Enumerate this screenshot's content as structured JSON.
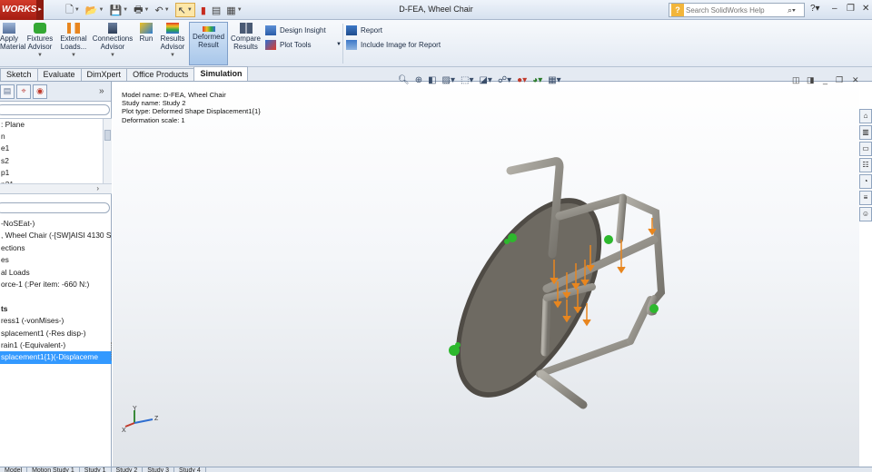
{
  "titlebar": {
    "brand": "WORKS",
    "document_title": "D-FEA, Wheel Chair",
    "help_placeholder": "Search SolidWorks Help"
  },
  "ribbon": {
    "apply_material": "Apply\nMaterial",
    "fixtures_advisor": "Fixtures\nAdvisor",
    "external_loads": "External\nLoads...",
    "connections_advisor": "Connections\nAdvisor",
    "run": "Run",
    "results_advisor": "Results\nAdvisor",
    "deformed_result": "Deformed\nResult",
    "compare_results": "Compare\nResults",
    "design_insight": "Design Insight",
    "plot_tools": "Plot Tools",
    "report": "Report",
    "include_image": "Include Image for Report"
  },
  "command_tabs": [
    "Sketch",
    "Evaluate",
    "DimXpert",
    "Office Products",
    "Simulation"
  ],
  "left_panel": {
    "upper_items": [
      ": Plane",
      "n",
      "e1",
      "s2",
      "p1",
      "p21"
    ],
    "tree_items": [
      {
        "label": "-NoSEat-)",
        "style": ""
      },
      {
        "label": ", Wheel Chair (-[SW]AISI 4130 S",
        "style": ""
      },
      {
        "label": "ections",
        "style": ""
      },
      {
        "label": "es",
        "style": ""
      },
      {
        "label": "al Loads",
        "style": ""
      },
      {
        "label": "orce-1 (:Per item: -660 N:)",
        "style": ""
      },
      {
        "label": "",
        "style": ""
      },
      {
        "label": "ts",
        "style": "bold"
      },
      {
        "label": "ress1 (-vonMises-)",
        "style": ""
      },
      {
        "label": "splacement1 (-Res disp-)",
        "style": ""
      },
      {
        "label": "rain1 (-Equivalent-)",
        "style": ""
      },
      {
        "label": "splacement1{1}(-Displaceme",
        "style": "selected"
      }
    ]
  },
  "viewport": {
    "info_lines": [
      "Model name: D-FEA, Wheel Chair",
      "Study name: Study 2",
      "Plot type: Deformed Shape Displacement1{1}",
      "Deformation scale: 1"
    ],
    "triad": {
      "x": "X",
      "y": "Y",
      "z": "Z"
    }
  },
  "bottom_tabs": [
    "Model",
    "Motion Study 1",
    "Study 1",
    "Study 2",
    "Study 3",
    "Study 4"
  ],
  "colors": {
    "accent": "#3399ff",
    "load_arrow": "#e8861f",
    "fixture": "#2db82d",
    "seat": "#6e6a62"
  }
}
